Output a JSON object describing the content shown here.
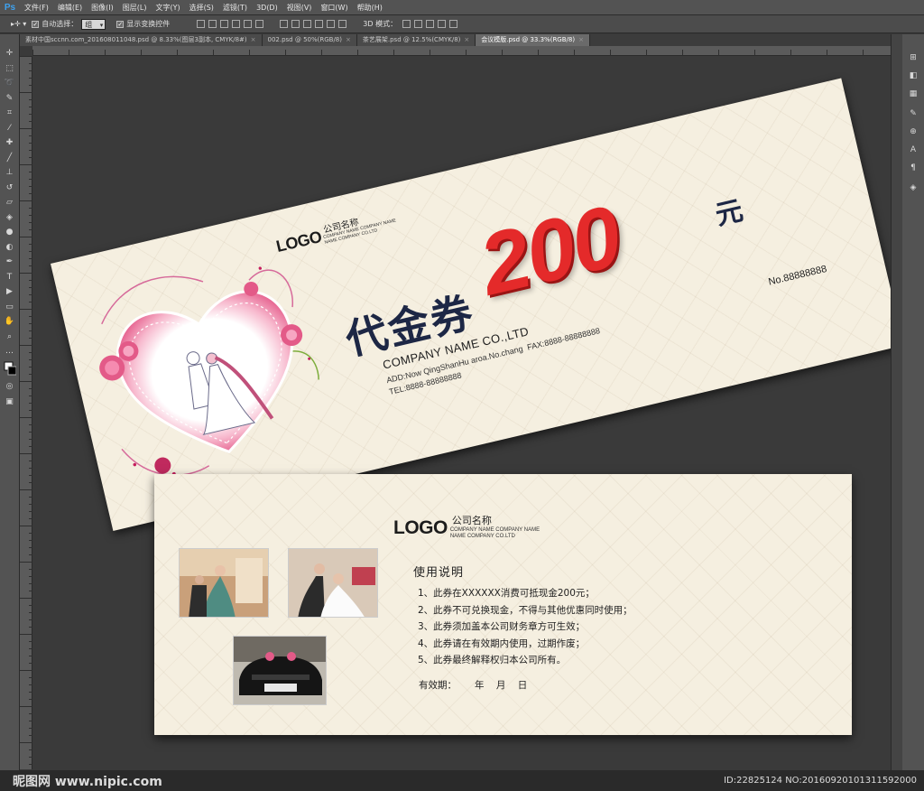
{
  "app": {
    "logo": "Ps",
    "menu": [
      "文件(F)",
      "编辑(E)",
      "图像(I)",
      "图层(L)",
      "文字(Y)",
      "选择(S)",
      "滤镜(T)",
      "3D(D)",
      "视图(V)",
      "窗口(W)",
      "帮助(H)"
    ]
  },
  "options": {
    "auto_select_label": "自动选择：",
    "auto_select_value": "组",
    "show_transform_label": "显示变换控件",
    "mode3d_label": "3D 模式："
  },
  "tabs": [
    {
      "label": "素材中国sccnn.com_201608011048.psd @ 8.33%(图层3副本, CMYK/8#)"
    },
    {
      "label": "002.psd @ 50%(RGB/8)"
    },
    {
      "label": "茶艺展架.psd @ 12.5%(CMYK/8)"
    },
    {
      "label": "会议模版.psd @ 33.3%(RGB/8)"
    }
  ],
  "front": {
    "logo": "LOGO",
    "logo_cn": "公司名称",
    "logo_sub_1": "COMPANY NAME COMPANY NAME",
    "logo_sub_2": "NAME COMPANY CO.LTD",
    "title": "代金券",
    "amount": "200",
    "unit": "元",
    "company": "COMPANY NAME CO.,LTD",
    "addr": "ADD:Now QingShanHu aroa.No.chang",
    "fax": "FAX:8888-88888888",
    "tel": "TEL:8888-88888888",
    "serial": "No.88888888"
  },
  "back": {
    "logo": "LOGO",
    "logo_cn": "公司名称",
    "logo_sub_1": "COMPANY NAME COMPANY NAME",
    "logo_sub_2": "NAME COMPANY CO.LTD",
    "usage_title": "使用说明",
    "rules": [
      "1、此券在XXXXXX消费可抵现金200元；",
      "2、此券不可兑换现金，不得与其他优惠同时使用；",
      "3、此券须加盖本公司财务章方可生效；",
      "4、此券请在有效期内使用，过期作废；",
      "5、此券最终解释权归本公司所有。"
    ],
    "validity_label": "有效期：",
    "year": "年",
    "month": "月",
    "day": "日"
  },
  "watermark": {
    "left": "昵图网 www.nipic.com",
    "right": "ID:22825124 NO:20160920101311592000"
  },
  "colors": {
    "accent_red": "#e42a2a",
    "navy": "#1d2745",
    "card_bg": "#f5efe0"
  }
}
